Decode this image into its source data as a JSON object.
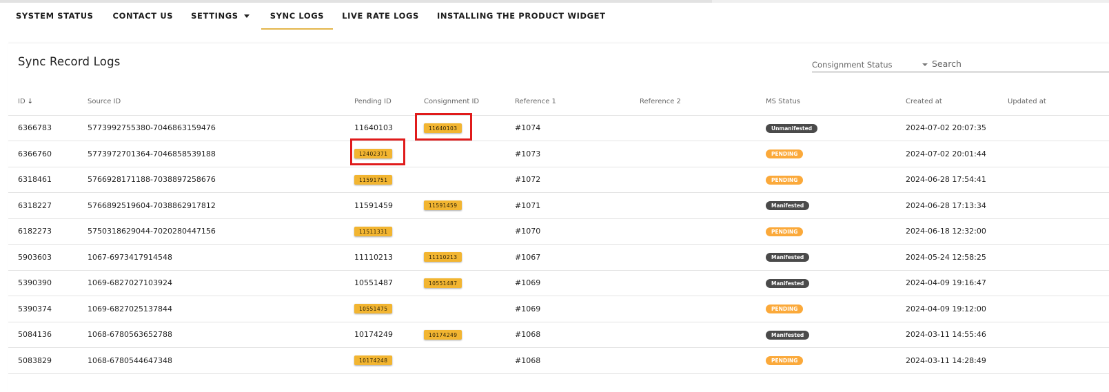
{
  "nav": {
    "tabs": [
      {
        "label": "SYSTEM STATUS",
        "active": false
      },
      {
        "label": "CONTACT US",
        "active": false
      },
      {
        "label": "SETTINGS",
        "active": false,
        "has_dropdown": true
      },
      {
        "label": "SYNC LOGS",
        "active": true
      },
      {
        "label": "LIVE RATE LOGS",
        "active": false
      },
      {
        "label": "INSTALLING THE PRODUCT WIDGET",
        "active": false
      }
    ]
  },
  "page": {
    "title": "Sync Record Logs",
    "filter_label": "Consignment Status",
    "search_placeholder": "Search"
  },
  "colors": {
    "accent": "#e3b54a",
    "chip": "#f2b531",
    "pending": "#fba93a",
    "manifested": "#4a4a4a",
    "highlight": "#e01b1b"
  },
  "table": {
    "columns": [
      "ID",
      "Source ID",
      "Pending ID",
      "Consignment ID",
      "Reference 1",
      "Reference 2",
      "MS Status",
      "Created at",
      "Updated at"
    ],
    "sort_icon": "arrow-down-icon",
    "rows": [
      {
        "id": "6366783",
        "source_id": "5773992755380-7046863159476",
        "pending_id": "11640103",
        "pending_chip": false,
        "consignment_id": "11640103",
        "reference1": "#1074",
        "reference2": "",
        "ms_status": "Unmanifested",
        "ms_kind": "dark",
        "created_at": "2024-07-02 20:07:35",
        "updated_at": ""
      },
      {
        "id": "6366760",
        "source_id": "5773972701364-7046858539188",
        "pending_id": "12402371",
        "pending_chip": true,
        "consignment_id": "",
        "reference1": "#1073",
        "reference2": "",
        "ms_status": "PENDING",
        "ms_kind": "orange",
        "created_at": "2024-07-02 20:01:44",
        "updated_at": ""
      },
      {
        "id": "6318461",
        "source_id": "5766928171188-7038897258676",
        "pending_id": "11591751",
        "pending_chip": true,
        "consignment_id": "",
        "reference1": "#1072",
        "reference2": "",
        "ms_status": "PENDING",
        "ms_kind": "orange",
        "created_at": "2024-06-28 17:54:41",
        "updated_at": ""
      },
      {
        "id": "6318227",
        "source_id": "5766892519604-7038862917812",
        "pending_id": "11591459",
        "pending_chip": false,
        "consignment_id": "11591459",
        "reference1": "#1071",
        "reference2": "",
        "ms_status": "Manifested",
        "ms_kind": "dark",
        "created_at": "2024-06-28 17:13:34",
        "updated_at": ""
      },
      {
        "id": "6182273",
        "source_id": "5750318629044-7020280447156",
        "pending_id": "11511331",
        "pending_chip": true,
        "consignment_id": "",
        "reference1": "#1070",
        "reference2": "",
        "ms_status": "PENDING",
        "ms_kind": "orange",
        "created_at": "2024-06-18 12:32:00",
        "updated_at": ""
      },
      {
        "id": "5903603",
        "source_id": "1067-6973417914548",
        "pending_id": "11110213",
        "pending_chip": false,
        "consignment_id": "11110213",
        "reference1": "#1067",
        "reference2": "",
        "ms_status": "Manifested",
        "ms_kind": "dark",
        "created_at": "2024-05-24 12:58:25",
        "updated_at": ""
      },
      {
        "id": "5390390",
        "source_id": "1069-6827027103924",
        "pending_id": "10551487",
        "pending_chip": false,
        "consignment_id": "10551487",
        "reference1": "#1069",
        "reference2": "",
        "ms_status": "Manifested",
        "ms_kind": "dark",
        "created_at": "2024-04-09 19:16:47",
        "updated_at": ""
      },
      {
        "id": "5390374",
        "source_id": "1069-6827025137844",
        "pending_id": "10551475",
        "pending_chip": true,
        "consignment_id": "",
        "reference1": "#1069",
        "reference2": "",
        "ms_status": "PENDING",
        "ms_kind": "orange",
        "created_at": "2024-04-09 19:12:00",
        "updated_at": ""
      },
      {
        "id": "5084136",
        "source_id": "1068-6780563652788",
        "pending_id": "10174249",
        "pending_chip": false,
        "consignment_id": "10174249",
        "reference1": "#1068",
        "reference2": "",
        "ms_status": "Manifested",
        "ms_kind": "dark",
        "created_at": "2024-03-11 14:55:46",
        "updated_at": ""
      },
      {
        "id": "5083829",
        "source_id": "1068-6780544647348",
        "pending_id": "10174248",
        "pending_chip": true,
        "consignment_id": "",
        "reference1": "#1068",
        "reference2": "",
        "ms_status": "PENDING",
        "ms_kind": "orange",
        "created_at": "2024-03-11 14:28:49",
        "updated_at": ""
      }
    ]
  },
  "annotations": [
    {
      "target": "row 1 consignment id chip",
      "style": "red-box"
    },
    {
      "target": "row 2 pending id chip",
      "style": "red-box"
    }
  ]
}
